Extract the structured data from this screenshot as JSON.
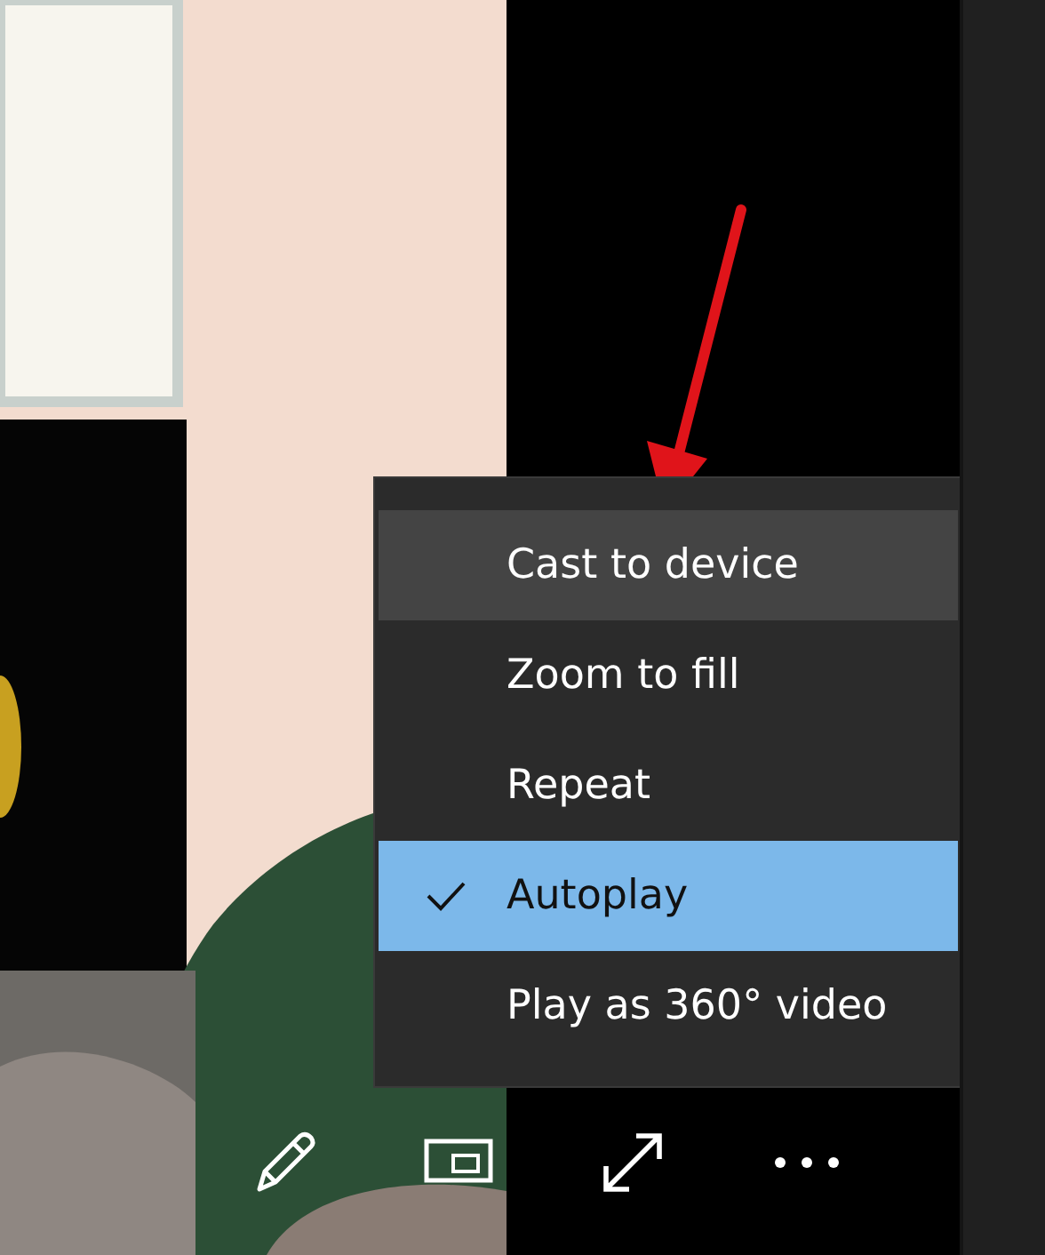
{
  "menu": {
    "items": [
      {
        "label": "Cast to device",
        "highlighted": true,
        "checked": false
      },
      {
        "label": "Zoom to fill",
        "highlighted": false,
        "checked": false
      },
      {
        "label": "Repeat",
        "highlighted": false,
        "checked": false
      },
      {
        "label": "Autoplay",
        "highlighted": false,
        "checked": true
      },
      {
        "label": "Play as 360° video",
        "highlighted": false,
        "checked": false
      }
    ]
  },
  "controls": [
    {
      "kind": "pencil"
    },
    {
      "kind": "mini"
    },
    {
      "kind": "expand"
    },
    {
      "kind": "more"
    }
  ]
}
